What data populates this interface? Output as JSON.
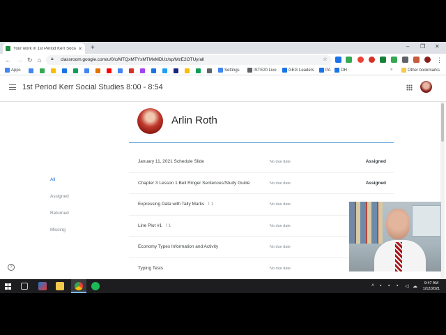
{
  "browser": {
    "tab_title": "Your work in 1st Period Kerr Social",
    "url": "classroom.google.com/u/0/c/MTQxMTYxMTMxMDUz/sp/MzE2OTUy/all",
    "bookmarks": [
      {
        "label": "Apps",
        "icon": "apps-grid-icon",
        "color": "#4285f4"
      },
      {
        "label": "Settings",
        "icon": "settings-icon",
        "color": "#4285f4"
      },
      {
        "label": "ISTE20 Live",
        "icon": "iste-icon",
        "color": "#5f6368"
      },
      {
        "label": "GEG Leaders",
        "icon": "geg-icon",
        "color": "#1a73e8"
      },
      {
        "label": "PA",
        "icon": "pa-icon",
        "color": "#1a73e8"
      },
      {
        "label": "OH",
        "icon": "oh-icon",
        "color": "#1a73e8"
      },
      {
        "label": "Other bookmarks",
        "icon": "folder-icon",
        "color": "#f2c94c"
      }
    ]
  },
  "classroom": {
    "class_title": "1st Period Kerr Social Studies 8:00 - 8:54",
    "student_name": "Arlin Roth",
    "filters": [
      "All",
      "Assigned",
      "Returned",
      "Missing"
    ],
    "active_filter": "All",
    "assignments": [
      {
        "title": "January 11, 2021 Schedule Slide",
        "attachments": "",
        "due": "No due date",
        "status": "Assigned"
      },
      {
        "title": "Chapter 3 Lesson 1 Bell Ringer Sentences/Study Guide",
        "attachments": "",
        "due": "No due date",
        "status": "Assigned"
      },
      {
        "title": "Expressing Data with Tally Marks",
        "attachments": "1",
        "due": "No due date",
        "status": ""
      },
      {
        "title": "Line Plot #1",
        "attachments": "1",
        "due": "No due date",
        "status": ""
      },
      {
        "title": "Economy Types Information and Activity",
        "attachments": "",
        "due": "No due date",
        "status": ""
      },
      {
        "title": "Typing Tests",
        "attachments": "",
        "due": "No due date",
        "status": ""
      }
    ]
  },
  "taskbar": {
    "time": "9:47 AM",
    "date": "1/12/2021"
  },
  "colors": {
    "accent_blue": "#1967d2",
    "divider_blue": "#5a9fd8"
  }
}
